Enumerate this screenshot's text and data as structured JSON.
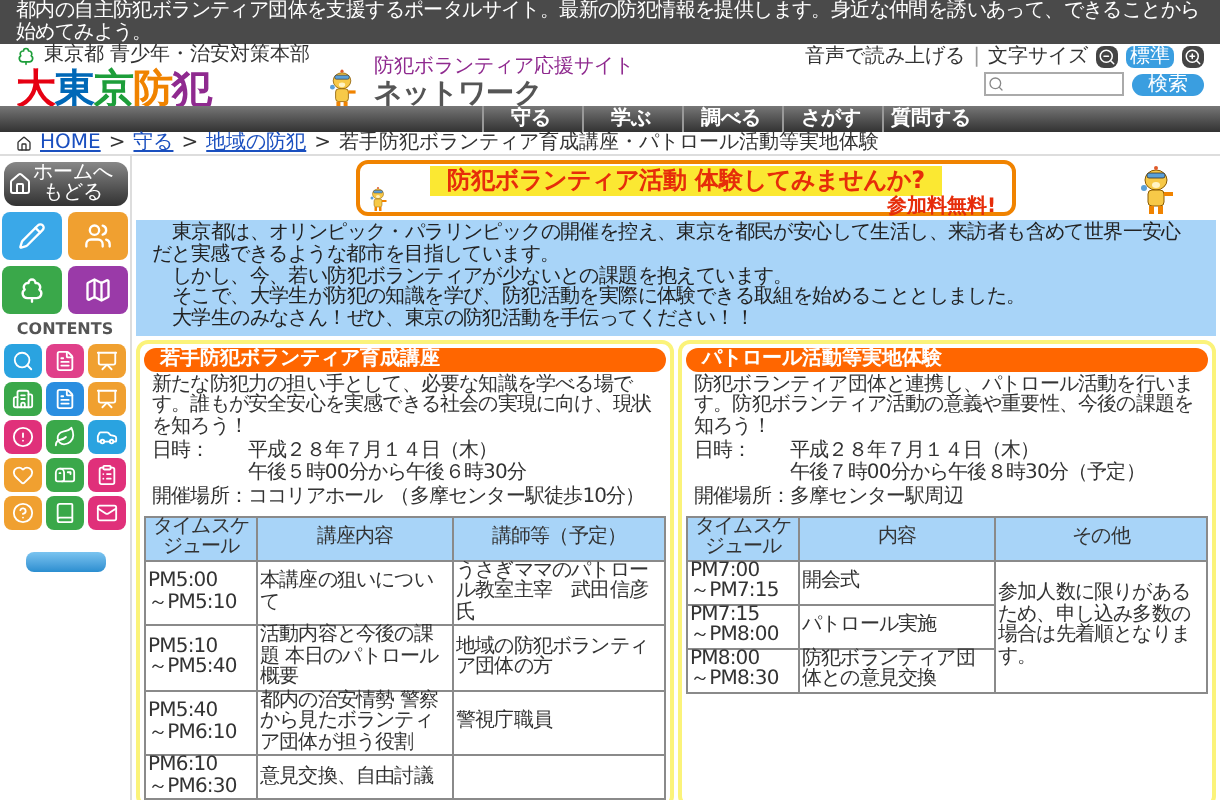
{
  "top_bar": {
    "text": "都内の自主防犯ボランティア団体を支援するポータルサイト。最新の防犯情報を提供します。身近な仲間を誘いあって、できることから始めてみよう。"
  },
  "header": {
    "agency": "東京都 青少年・治安対策本部",
    "logo_main": "大東京防犯",
    "logo_sub": "防犯ボランティア応援サイト",
    "logo_network": "ネットワーク",
    "read_aloud": "音声で読み上げる",
    "separator": "|",
    "text_size_label": "文字サイズ",
    "text_size_standard": "標準",
    "search": {
      "button": "検索"
    }
  },
  "nav": {
    "items": [
      "守る",
      "学ぶ",
      "調べる",
      "さがす",
      "質問する"
    ]
  },
  "breadcrumb": {
    "separator": ">",
    "home": "HOME",
    "links": [
      "守る",
      "地域の防犯"
    ],
    "current": "若手防犯ボランティア育成講座・パトロール活動等実地体験"
  },
  "sidebar": {
    "home_button": [
      "ホームへ",
      "もどる"
    ],
    "contents_heading": "CONTENTS"
  },
  "banner": {
    "title": "防犯ボランティア活動 体験してみませんか?",
    "free": "参加料無料!"
  },
  "intro": {
    "paragraphs": [
      "東京都は、オリンピック・パラリンピックの開催を控え、東京を都民が安心して生活し、来訪者も含めて世界一安心だと実感できるような都市を目指しています。",
      "しかし、今、若い防犯ボランティアが少ないとの課題を抱えています。",
      "そこで、大学生が防犯の知識を学び、防犯活動を実際に体験できる取組を始めることとしました。",
      "大学生のみなさん！ぜひ、東京の防犯活動を手伝ってください！！"
    ]
  },
  "events": [
    {
      "title": "若手防犯ボランティア育成講座",
      "description": "新たな防犯力の担い手として、必要な知識を学べる場です。誰もが安全安心を実感できる社会の実現に向け、現状を知ろう！",
      "details": [
        {
          "label": "日時：",
          "lines": [
            "平成２８年７月１４日（木）",
            "午後５時00分から午後６時30分"
          ]
        },
        {
          "label": "開催場所：",
          "lines": [
            "ココリアホール",
            "（多摩センター駅徒歩10分）"
          ]
        }
      ],
      "table": {
        "columns": [
          "タイムスケジュール",
          "講座内容",
          "講師等（予定）"
        ],
        "merged_last": false,
        "rows": [
          {
            "time": [
              "PM5:00",
              "～PM5:10"
            ],
            "content": "本講座の狙いについて",
            "other": "うさぎママのパトロール教室主宰　武田信彦氏"
          },
          {
            "time": [
              "PM5:10",
              "～PM5:40"
            ],
            "content": "活動内容と今後の課題 本日のパトロール概要",
            "other": "地域の防犯ボランティア団体の方"
          },
          {
            "time": [
              "PM5:40",
              "～PM6:10"
            ],
            "content": "都内の治安情勢 警察から見たボランティア団体が担う役割",
            "other": "警視庁職員"
          },
          {
            "time": [
              "PM6:10",
              "～PM6:30"
            ],
            "content": "意見交換、自由討議"
          }
        ]
      }
    },
    {
      "title": "パトロール活動等実地体験",
      "description": "防犯ボランティア団体と連携し、パトロール活動を行います。防犯ボランティア活動の意義や重要性、今後の課題を知ろう！",
      "details": [
        {
          "label": "日時：",
          "lines": [
            "平成２８年７月１４日（木）",
            "午後７時00分から午後８時30分（予定）"
          ]
        },
        {
          "label": "開催場所：",
          "lines": [
            "多摩センター駅周辺"
          ]
        }
      ],
      "table": {
        "columns": [
          "タイムスケジュール",
          "内容",
          "その他"
        ],
        "merged_last": true,
        "merged_text": "参加人数に限りがあるため、申し込み多数の場合は先着順となります。",
        "rows": [
          {
            "time": [
              "PM7:00",
              "～PM7:15"
            ],
            "content": "開会式"
          },
          {
            "time": [
              "PM7:15",
              "～PM8:00"
            ],
            "content": "パトロール実施"
          },
          {
            "time": [
              "PM8:00",
              "～PM8:30"
            ],
            "content": "防犯ボランティア団体との意見交換"
          }
        ]
      }
    }
  ]
}
